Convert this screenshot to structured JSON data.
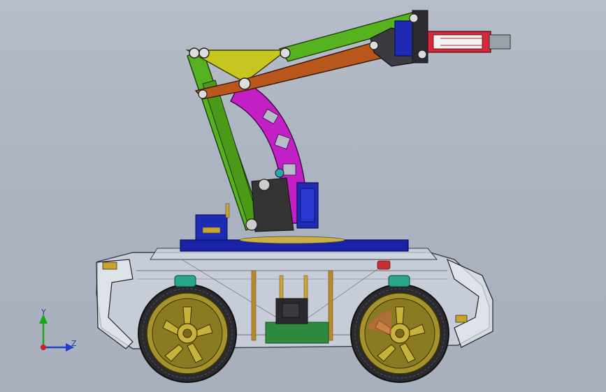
{
  "viewport": {
    "background_top": "#b6bdc8",
    "background_bottom": "#a9b0bd"
  },
  "triad": {
    "y_label": "Y",
    "z_label": "Z",
    "y_axis_color": "#1fa31f",
    "z_axis_color": "#1f3fd1",
    "x_axis_color": "#d11f1f"
  },
  "model": {
    "icons": [
      "robot-car-model-icon",
      "robotic-arm-icon",
      "gripper-icon",
      "wheel-icon",
      "servo-icon"
    ],
    "colors": {
      "arm_green": "#56b21e",
      "arm_yellow": "#c7c61e",
      "arm_orange": "#b8561c",
      "arm_magenta": "#c21fc4",
      "servo_blue": "#1f2bb5",
      "gripper_red": "#d52a3a",
      "base_plate_blue": "#1a22a8",
      "wheel_gold": "#a5922a",
      "tire_dark": "#2a2a2e",
      "chassis_transparent": "#d8dee8"
    }
  }
}
